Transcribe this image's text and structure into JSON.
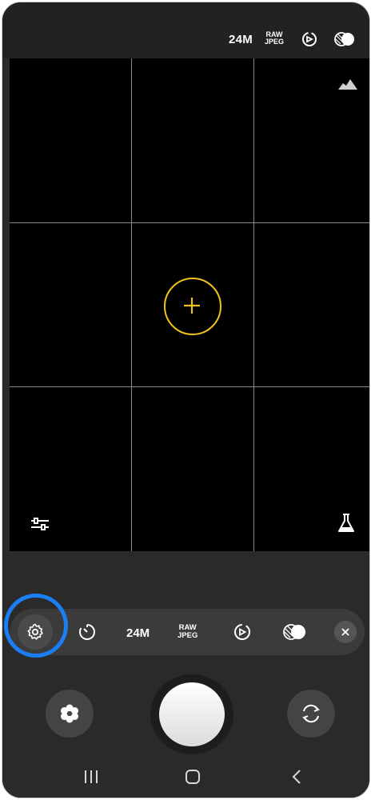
{
  "status_bar": {
    "resolution": "24M",
    "format_top": "RAW",
    "format_bottom": "JPEG",
    "icons": [
      "motion-photo-icon",
      "filter-icon"
    ]
  },
  "viewfinder": {
    "grid": "3x3",
    "icons": [
      "histogram-icon",
      "adjust-sliders-icon",
      "lab-flask-icon"
    ],
    "focus_color": "#f2c21b"
  },
  "quick_settings": {
    "items": [
      "settings-icon",
      "timer-icon",
      "resolution",
      "format",
      "motion-photo-icon",
      "filter-icon",
      "close-icon"
    ],
    "resolution": "24M",
    "format_top": "RAW",
    "format_bottom": "JPEG",
    "highlight_color": "#1a7ef5"
  },
  "controls": {
    "icons": [
      "effects-icon",
      "shutter-button",
      "flip-camera-icon"
    ]
  },
  "navigation": {
    "icons": [
      "recent-apps-icon",
      "home-icon",
      "back-icon"
    ]
  }
}
